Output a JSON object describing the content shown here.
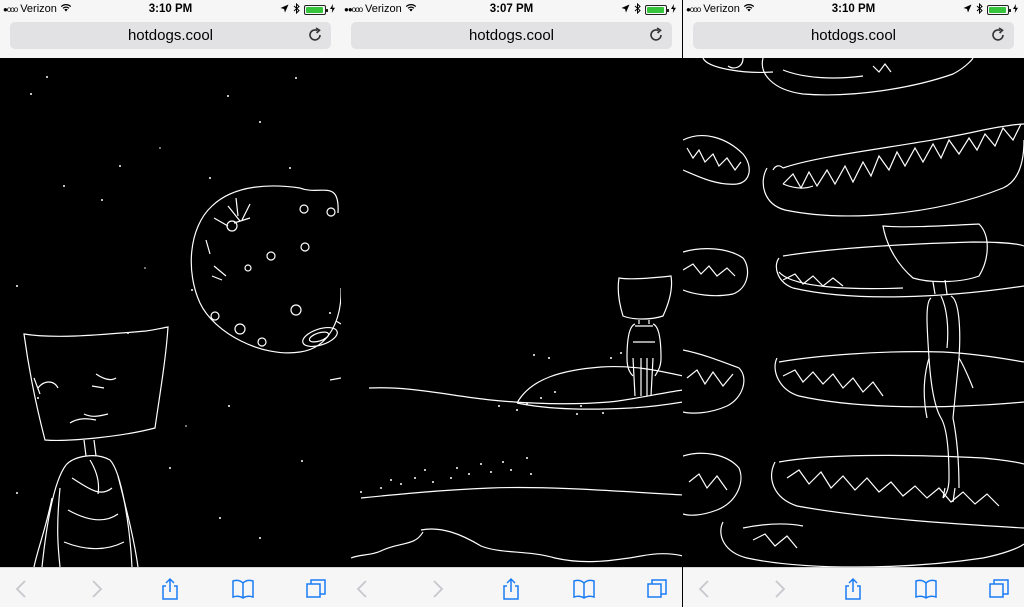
{
  "phones": [
    {
      "carrier": "Verizon",
      "signal": "●ooo",
      "time": "3:10 PM",
      "url": "hotdogs.cool",
      "scene": "moon"
    },
    {
      "carrier": "Verizon",
      "signal": "●●ooo",
      "time": "3:07 PM",
      "url": "hotdogs.cool",
      "scene": "island"
    },
    {
      "carrier": "Verizon",
      "signal": "●ooo",
      "time": "3:10 PM",
      "url": "hotdogs.cool",
      "scene": "hotdogs"
    }
  ],
  "colors": {
    "chrome": "#f6f6f7",
    "urlbar": "#e2e2e5",
    "accent": "#1a7cf5",
    "battery": "#35c43c",
    "content": "#000000",
    "line": "#ffffff"
  },
  "toolbar_icons": [
    "back-chevron-icon",
    "forward-chevron-icon",
    "share-icon",
    "bookmarks-icon",
    "tabs-icon"
  ]
}
